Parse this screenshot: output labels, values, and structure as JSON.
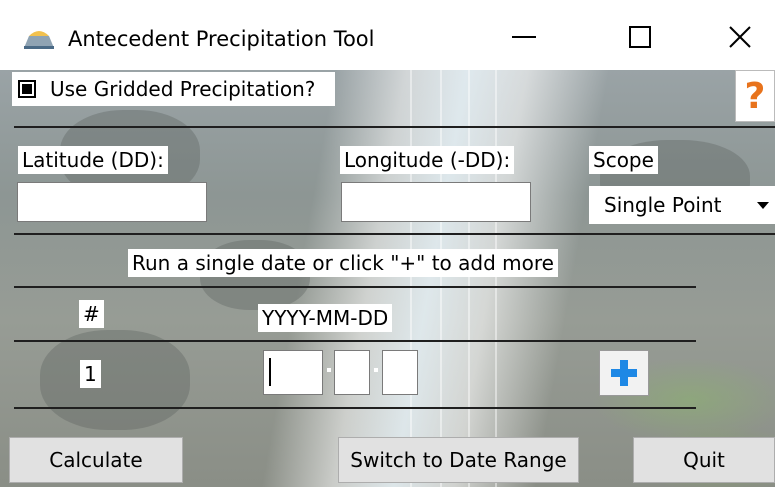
{
  "window": {
    "title": "Antecedent Precipitation Tool",
    "controls": [
      "minimize-icon",
      "maximize-icon",
      "close-icon"
    ]
  },
  "gridded": {
    "label": "Use Gridded Precipitation?",
    "checked": true
  },
  "help": {
    "label": "?",
    "color": "#e8731c"
  },
  "latitude": {
    "label": "Latitude (DD):",
    "value": ""
  },
  "longitude": {
    "label": "Longitude (-DD):",
    "value": ""
  },
  "scope": {
    "label": "Scope",
    "selected": "Single Point"
  },
  "instruction": "Run a single date or click \"+\" to add more",
  "table": {
    "headers": [
      "#",
      "YYYY-MM-DD"
    ],
    "rows": [
      {
        "index": "1",
        "year": "",
        "month": "",
        "day": ""
      }
    ]
  },
  "add_button_color": "#1e88e5",
  "buttons": {
    "calculate": "Calculate",
    "switch": "Switch to Date Range",
    "quit": "Quit"
  }
}
